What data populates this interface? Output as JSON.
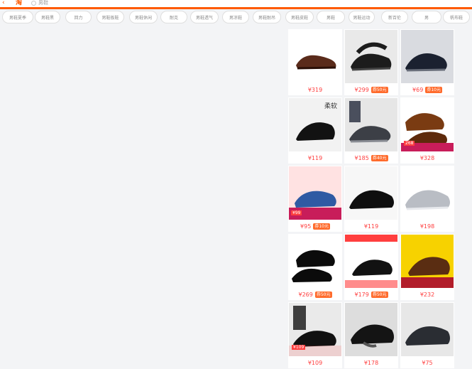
{
  "header": {
    "back_icon": "back-icon",
    "logo_text": "淘",
    "search_query": "男鞋"
  },
  "chips": [
    "男鞋夏季",
    "男鞋黑",
    "回力",
    "男鞋板鞋",
    "男鞋休闲",
    "耐克",
    "男鞋透气",
    "男凉鞋",
    "男鞋耐吊",
    "男鞋皮鞋",
    "男鞋",
    "男鞋运动",
    "新百伦",
    "男",
    "帆布鞋"
  ],
  "products": [
    {
      "price": "¥319"
    },
    {
      "price": "¥299",
      "coupon": "券50元"
    },
    {
      "price": "¥69",
      "coupon": "券10元"
    },
    {
      "price": "¥119"
    },
    {
      "price": "¥185",
      "coupon": "券40元"
    },
    {
      "price": "¥328",
      "badge": "268"
    },
    {
      "price": "¥95",
      "coupon": "券10元",
      "badge": "¥99"
    },
    {
      "price": "¥119"
    },
    {
      "price": "¥198"
    },
    {
      "price": "¥269",
      "coupon": "券50元"
    },
    {
      "price": "¥179",
      "coupon": "券50元"
    },
    {
      "price": "¥232"
    },
    {
      "price": "¥109",
      "badge": "¥109"
    },
    {
      "price": "¥178"
    },
    {
      "price": "¥75"
    }
  ],
  "colors": {
    "accent": "#ff5a00",
    "price": "#ff3f3f",
    "coupon": "#ff6b2c"
  }
}
